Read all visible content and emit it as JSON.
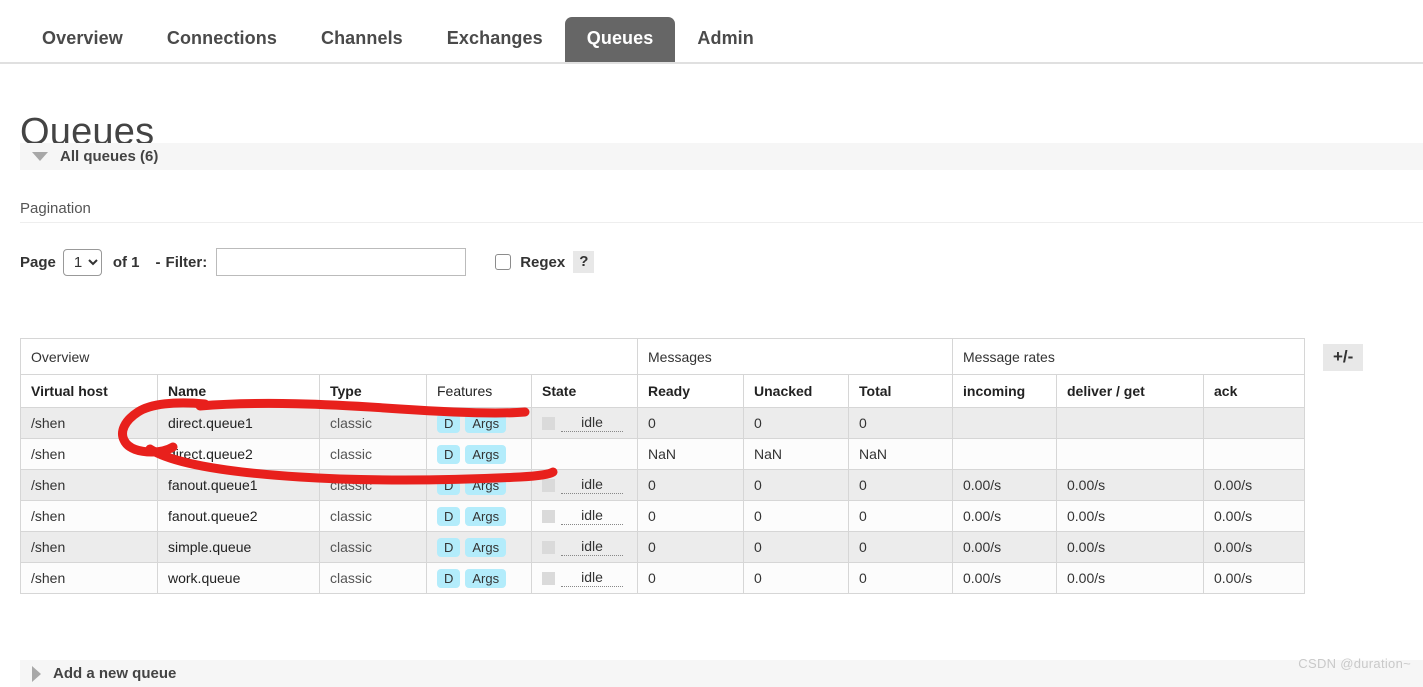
{
  "nav": {
    "items": [
      {
        "label": "Overview",
        "active": false
      },
      {
        "label": "Connections",
        "active": false
      },
      {
        "label": "Channels",
        "active": false
      },
      {
        "label": "Exchanges",
        "active": false
      },
      {
        "label": "Queues",
        "active": true
      },
      {
        "label": "Admin",
        "active": false
      }
    ]
  },
  "page": {
    "title": "Queues",
    "all_queues_label": "All queues (6)",
    "add_queue_label": "Add a new queue"
  },
  "pagination": {
    "heading": "Pagination",
    "page_label": "Page",
    "page_value": "1",
    "page_options": [
      "1"
    ],
    "of_label": "of 1",
    "dash": "-",
    "filter_label": "Filter:",
    "filter_value": "",
    "filter_placeholder": "",
    "regex_label": "Regex",
    "regex_checked": false,
    "help_label": "?"
  },
  "table": {
    "column_toggle_label": "+/-",
    "groups": [
      {
        "label": "Overview",
        "span": 5
      },
      {
        "label": "Messages",
        "span": 3
      },
      {
        "label": "Message rates",
        "span": 3
      }
    ],
    "columns": [
      {
        "label": "Virtual host",
        "bold": true,
        "align": "left"
      },
      {
        "label": "Name",
        "bold": true,
        "align": "left"
      },
      {
        "label": "Type",
        "bold": true,
        "align": "left"
      },
      {
        "label": "Features",
        "bold": false,
        "align": "left"
      },
      {
        "label": "State",
        "bold": true,
        "align": "left"
      },
      {
        "label": "Ready",
        "bold": true,
        "align": "left"
      },
      {
        "label": "Unacked",
        "bold": true,
        "align": "left"
      },
      {
        "label": "Total",
        "bold": true,
        "align": "left"
      },
      {
        "label": "incoming",
        "bold": true,
        "align": "left"
      },
      {
        "label": "deliver / get",
        "bold": true,
        "align": "left"
      },
      {
        "label": "ack",
        "bold": true,
        "align": "left"
      }
    ],
    "rows": [
      {
        "vhost": "/shen",
        "name": "direct.queue1",
        "type": "classic",
        "features": [
          "D",
          "Args"
        ],
        "state": "idle",
        "has_state": true,
        "ready": "0",
        "unacked": "0",
        "total": "0",
        "incoming": "",
        "deliver_get": "",
        "ack": ""
      },
      {
        "vhost": "/shen",
        "name": "direct.queue2",
        "type": "classic",
        "features": [
          "D",
          "Args"
        ],
        "state": "",
        "has_state": false,
        "ready": "NaN",
        "unacked": "NaN",
        "total": "NaN",
        "incoming": "",
        "deliver_get": "",
        "ack": ""
      },
      {
        "vhost": "/shen",
        "name": "fanout.queue1",
        "type": "classic",
        "features": [
          "D",
          "Args"
        ],
        "state": "idle",
        "has_state": true,
        "ready": "0",
        "unacked": "0",
        "total": "0",
        "incoming": "0.00/s",
        "deliver_get": "0.00/s",
        "ack": "0.00/s"
      },
      {
        "vhost": "/shen",
        "name": "fanout.queue2",
        "type": "classic",
        "features": [
          "D",
          "Args"
        ],
        "state": "idle",
        "has_state": true,
        "ready": "0",
        "unacked": "0",
        "total": "0",
        "incoming": "0.00/s",
        "deliver_get": "0.00/s",
        "ack": "0.00/s"
      },
      {
        "vhost": "/shen",
        "name": "simple.queue",
        "type": "classic",
        "features": [
          "D",
          "Args"
        ],
        "state": "idle",
        "has_state": true,
        "ready": "0",
        "unacked": "0",
        "total": "0",
        "incoming": "0.00/s",
        "deliver_get": "0.00/s",
        "ack": "0.00/s"
      },
      {
        "vhost": "/shen",
        "name": "work.queue",
        "type": "classic",
        "features": [
          "D",
          "Args"
        ],
        "state": "idle",
        "has_state": true,
        "ready": "0",
        "unacked": "0",
        "total": "0",
        "incoming": "0.00/s",
        "deliver_get": "0.00/s",
        "ack": "0.00/s"
      }
    ]
  },
  "annotation": {
    "color": "#e8201c",
    "shape": "hand-drawn-oval-highlight"
  },
  "watermark": {
    "text": "CSDN @duration~"
  },
  "colors": {
    "active_tab_bg": "#666666",
    "badge_bg": "#b3ecfb",
    "section_bg": "#f6f6f6",
    "row_odd": "#ececec",
    "row_even": "#fcfcfc",
    "annotation_red": "#e8201c"
  }
}
